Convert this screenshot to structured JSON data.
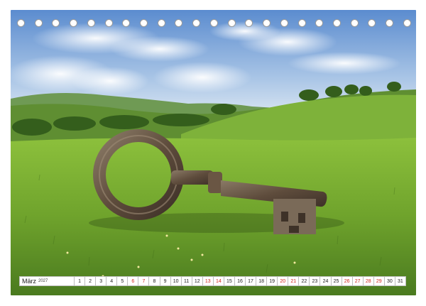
{
  "photo": {
    "subject-description": "",
    "colors": {
      "sky_top": "#5f8fd0",
      "sky_bottom": "#d9e6f3",
      "grass_light": "#8bbf3a",
      "grass_dark": "#4f7f22",
      "key": "#6b5a48"
    }
  },
  "binding": {
    "hole_count": 23
  },
  "calendar": {
    "month_label": "März",
    "year_label": "2027",
    "weekend_color": "#d1261c",
    "days": [
      {
        "n": "1",
        "weekend": false
      },
      {
        "n": "2",
        "weekend": false
      },
      {
        "n": "3",
        "weekend": false
      },
      {
        "n": "4",
        "weekend": false
      },
      {
        "n": "5",
        "weekend": false
      },
      {
        "n": "6",
        "weekend": true
      },
      {
        "n": "7",
        "weekend": true
      },
      {
        "n": "8",
        "weekend": false
      },
      {
        "n": "9",
        "weekend": false
      },
      {
        "n": "10",
        "weekend": false
      },
      {
        "n": "11",
        "weekend": false
      },
      {
        "n": "12",
        "weekend": false
      },
      {
        "n": "13",
        "weekend": true
      },
      {
        "n": "14",
        "weekend": true
      },
      {
        "n": "15",
        "weekend": false
      },
      {
        "n": "16",
        "weekend": false
      },
      {
        "n": "17",
        "weekend": false
      },
      {
        "n": "18",
        "weekend": false
      },
      {
        "n": "19",
        "weekend": false
      },
      {
        "n": "20",
        "weekend": true
      },
      {
        "n": "21",
        "weekend": true
      },
      {
        "n": "22",
        "weekend": false
      },
      {
        "n": "23",
        "weekend": false
      },
      {
        "n": "24",
        "weekend": false
      },
      {
        "n": "25",
        "weekend": false
      },
      {
        "n": "26",
        "weekend": true
      },
      {
        "n": "27",
        "weekend": true
      },
      {
        "n": "28",
        "weekend": true
      },
      {
        "n": "29",
        "weekend": true
      },
      {
        "n": "30",
        "weekend": false
      },
      {
        "n": "31",
        "weekend": false
      }
    ]
  }
}
